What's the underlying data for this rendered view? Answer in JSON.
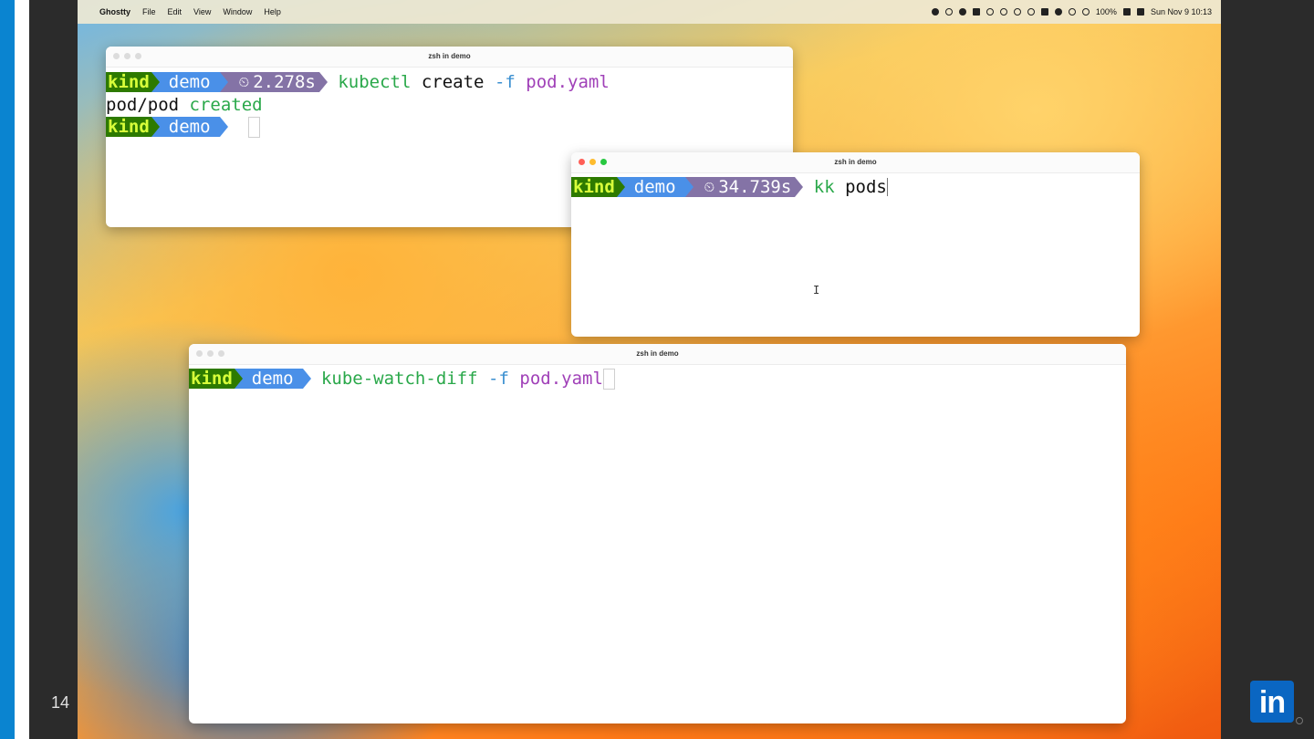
{
  "slide": {
    "number": "14",
    "logo_text": "in"
  },
  "menubar": {
    "apple": "",
    "app_name": "Ghostty",
    "menus": [
      "File",
      "Edit",
      "View",
      "Window",
      "Help"
    ],
    "battery": "100%",
    "datetime": "Sun Nov 9  10:13"
  },
  "windows": {
    "w1": {
      "title": "zsh in demo",
      "prompt": {
        "context": "kind",
        "namespace": "demo",
        "duration": "2.278s",
        "timer_icon": "⏲"
      },
      "command": {
        "cmd": "kubectl",
        "arg1": "create",
        "flag": "-f",
        "file": "pod.yaml"
      },
      "output": {
        "name": "pod/pod",
        "status": "created"
      },
      "prompt2": {
        "context": "kind",
        "namespace": "demo"
      }
    },
    "w2": {
      "title": "zsh in demo",
      "prompt": {
        "context": "kind",
        "namespace": "demo",
        "duration": "34.739s",
        "timer_icon": "⏲"
      },
      "command": {
        "cmd": "kk",
        "arg1": "pods"
      },
      "ibeam": "I"
    },
    "w3": {
      "title": "zsh in demo",
      "prompt": {
        "context": "kind",
        "namespace": "demo"
      },
      "command": {
        "cmd": "kube-watch-diff",
        "flag": "-f",
        "file": "pod.yaml"
      }
    }
  },
  "colors": {
    "kind_bg": "#2d7a00",
    "kind_fg": "#d8ff3a",
    "namespace_bg": "#4a90e8",
    "duration_bg": "#8473a6",
    "command": "#2aa84a",
    "flag": "#3a8fd0",
    "file": "#a040b8"
  }
}
